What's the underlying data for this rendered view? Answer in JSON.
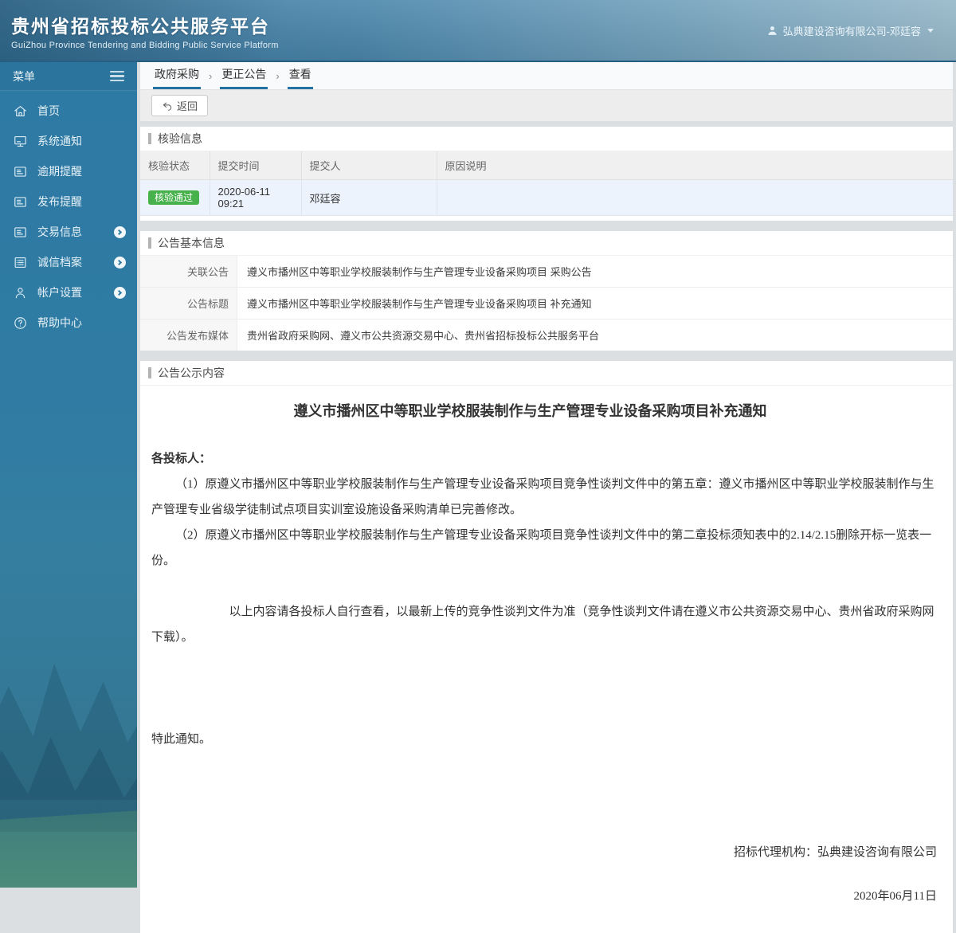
{
  "header": {
    "title": "贵州省招标投标公共服务平台",
    "subtitle": "GuiZhou Province Tendering and Bidding Public Service Platform",
    "user": "弘典建设咨询有限公司-邓廷容"
  },
  "sidebar": {
    "menu_label": "菜单",
    "items": [
      {
        "label": "首页",
        "icon": "home-icon",
        "has_submenu": false
      },
      {
        "label": "系统通知",
        "icon": "monitor-icon",
        "has_submenu": false
      },
      {
        "label": "逾期提醒",
        "icon": "document-lines-icon",
        "has_submenu": false
      },
      {
        "label": "发布提醒",
        "icon": "document-lines-icon",
        "has_submenu": false
      },
      {
        "label": "交易信息",
        "icon": "document-lines-icon",
        "has_submenu": true
      },
      {
        "label": "诚信档案",
        "icon": "list-icon",
        "has_submenu": true
      },
      {
        "label": "帐户设置",
        "icon": "user-icon",
        "has_submenu": true
      },
      {
        "label": "帮助中心",
        "icon": "help-icon",
        "has_submenu": false
      }
    ]
  },
  "breadcrumb": {
    "items": [
      "政府采购",
      "更正公告",
      "查看"
    ],
    "separator": "›"
  },
  "toolbar": {
    "back_label": "返回"
  },
  "verification": {
    "section_title": "核验信息",
    "columns": [
      "核验状态",
      "提交时间",
      "提交人",
      "原因说明"
    ],
    "row": {
      "status": "核验通过",
      "submit_time": "2020-06-11 09:21",
      "submitter": "邓廷容",
      "reason": ""
    }
  },
  "announcement_info": {
    "section_title": "公告基本信息",
    "fields": [
      {
        "label": "关联公告",
        "value": "遵义市播州区中等职业学校服装制作与生产管理专业设备采购项目 采购公告"
      },
      {
        "label": "公告标题",
        "value": "遵义市播州区中等职业学校服装制作与生产管理专业设备采购项目 补充通知"
      },
      {
        "label": "公告发布媒体",
        "value": "贵州省政府采购网、遵义市公共资源交易中心、贵州省招标投标公共服务平台"
      }
    ]
  },
  "notice": {
    "section_title": "公告公示内容",
    "title": "遵义市播州区中等职业学校服装制作与生产管理专业设备采购项目补充通知",
    "salutation": "各投标人：",
    "paragraph_1": "（1）原遵义市播州区中等职业学校服装制作与生产管理专业设备采购项目竞争性谈判文件中的第五章：遵义市播州区中等职业学校服装制作与生产管理专业省级学徒制试点项目实训室设施设备采购清单已完善修改。",
    "paragraph_2": "（2）原遵义市播州区中等职业学校服装制作与生产管理专业设备采购项目竞争性谈判文件中的第二章投标须知表中的2.14/2.15删除开标一览表一份。",
    "paragraph_3": "以上内容请各投标人自行查看，以最新上传的竞争性谈判文件为准（竞争性谈判文件请在遵义市公共资源交易中心、贵州省政府采购网下载）。",
    "closing": "特此通知。",
    "agency": "招标代理机构：弘典建设咨询有限公司",
    "date": "2020年06月11日"
  },
  "colors": {
    "accent_blue": "#2d7aa4",
    "breadcrumb_underline": "#2472a3",
    "badge_green": "#47b14b",
    "highlight_row": "#edf3fc"
  }
}
